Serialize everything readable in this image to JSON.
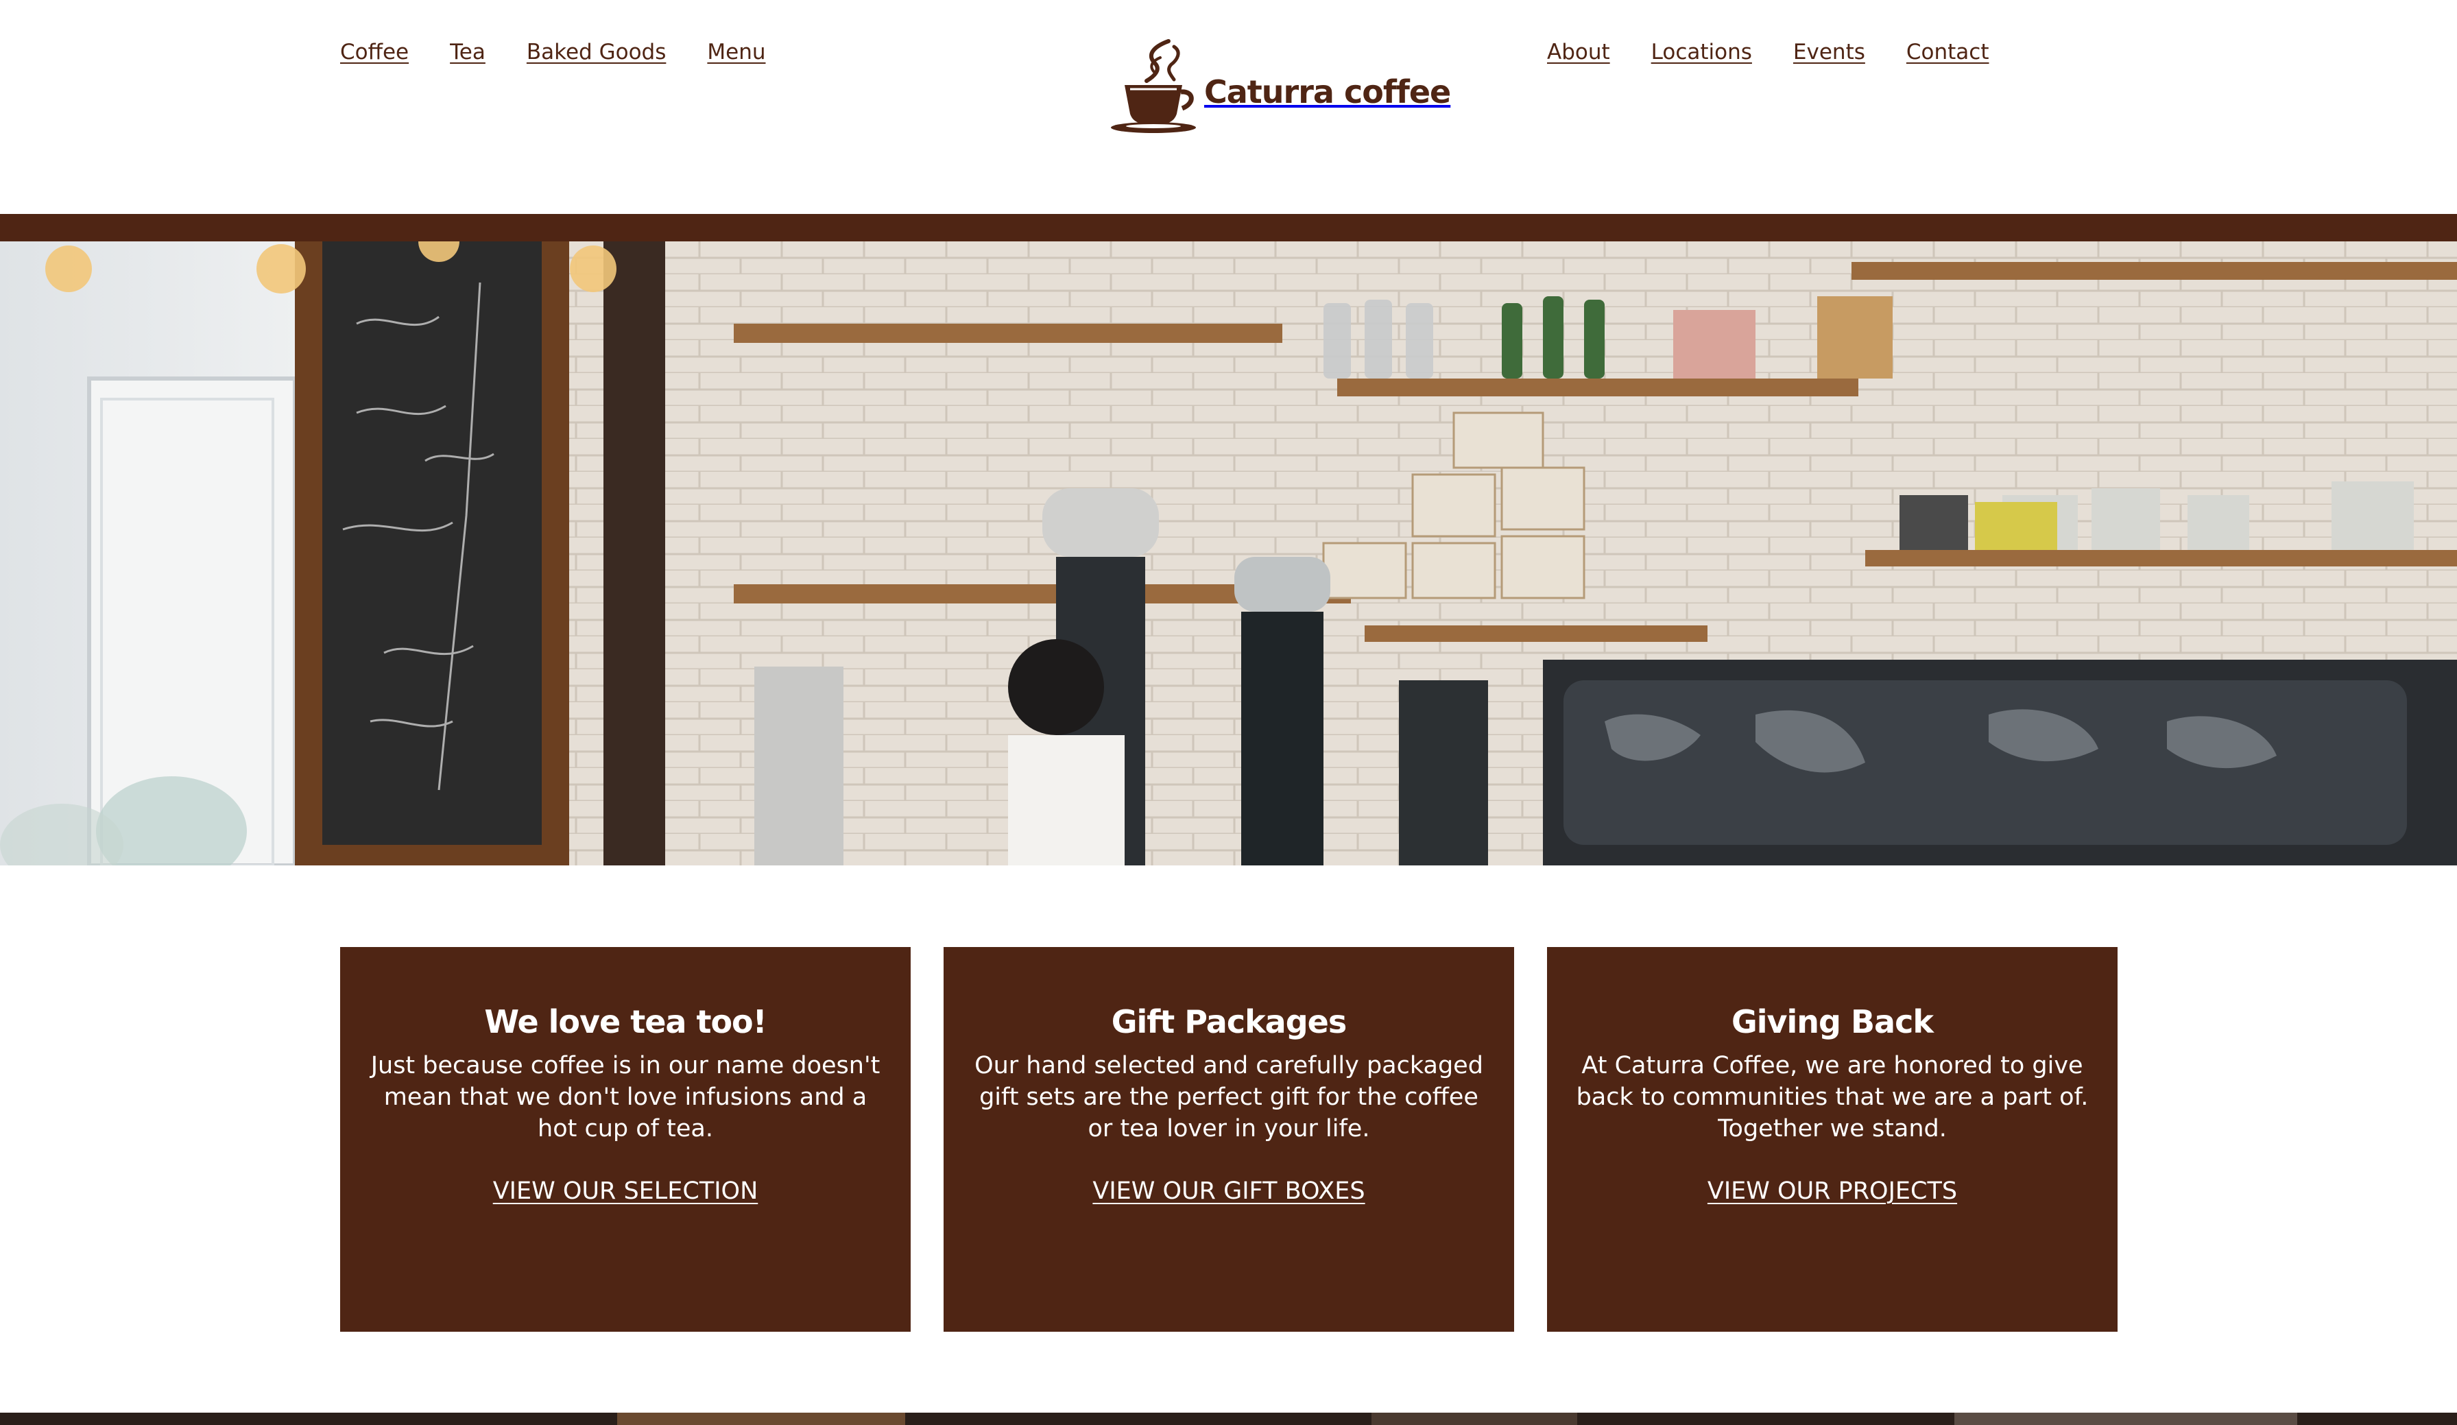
{
  "nav": {
    "left": [
      "Coffee",
      "Tea",
      "Baked Goods",
      "Menu"
    ],
    "right": [
      "About",
      "Locations",
      "Events",
      "Contact"
    ]
  },
  "brand": {
    "name": "Caturra coffee",
    "logo_icon": "coffee-cup-icon"
  },
  "hero": {
    "image": "cafe-interior-photo"
  },
  "cards": [
    {
      "title": "We love tea too!",
      "text": "Just because coffee is in our name doesn't mean that we don't love infusions and a hot cup of tea.",
      "link": "VIEW OUR SELECTION"
    },
    {
      "title": "Gift Packages",
      "text": "Our hand selected and carefully packaged gift sets are the perfect gift for the coffee or tea lover in your life.",
      "link": "VIEW OUR GIFT BOXES"
    },
    {
      "title": "Giving Back",
      "text": "At Caturra Coffee, we are honored to give back to communities that we are a part of. Together we stand.",
      "link": "VIEW OUR PROJECTS"
    }
  ],
  "colors": {
    "brand_brown": "#4f2514",
    "background": "#ffffff",
    "card_text": "#ffffff"
  }
}
